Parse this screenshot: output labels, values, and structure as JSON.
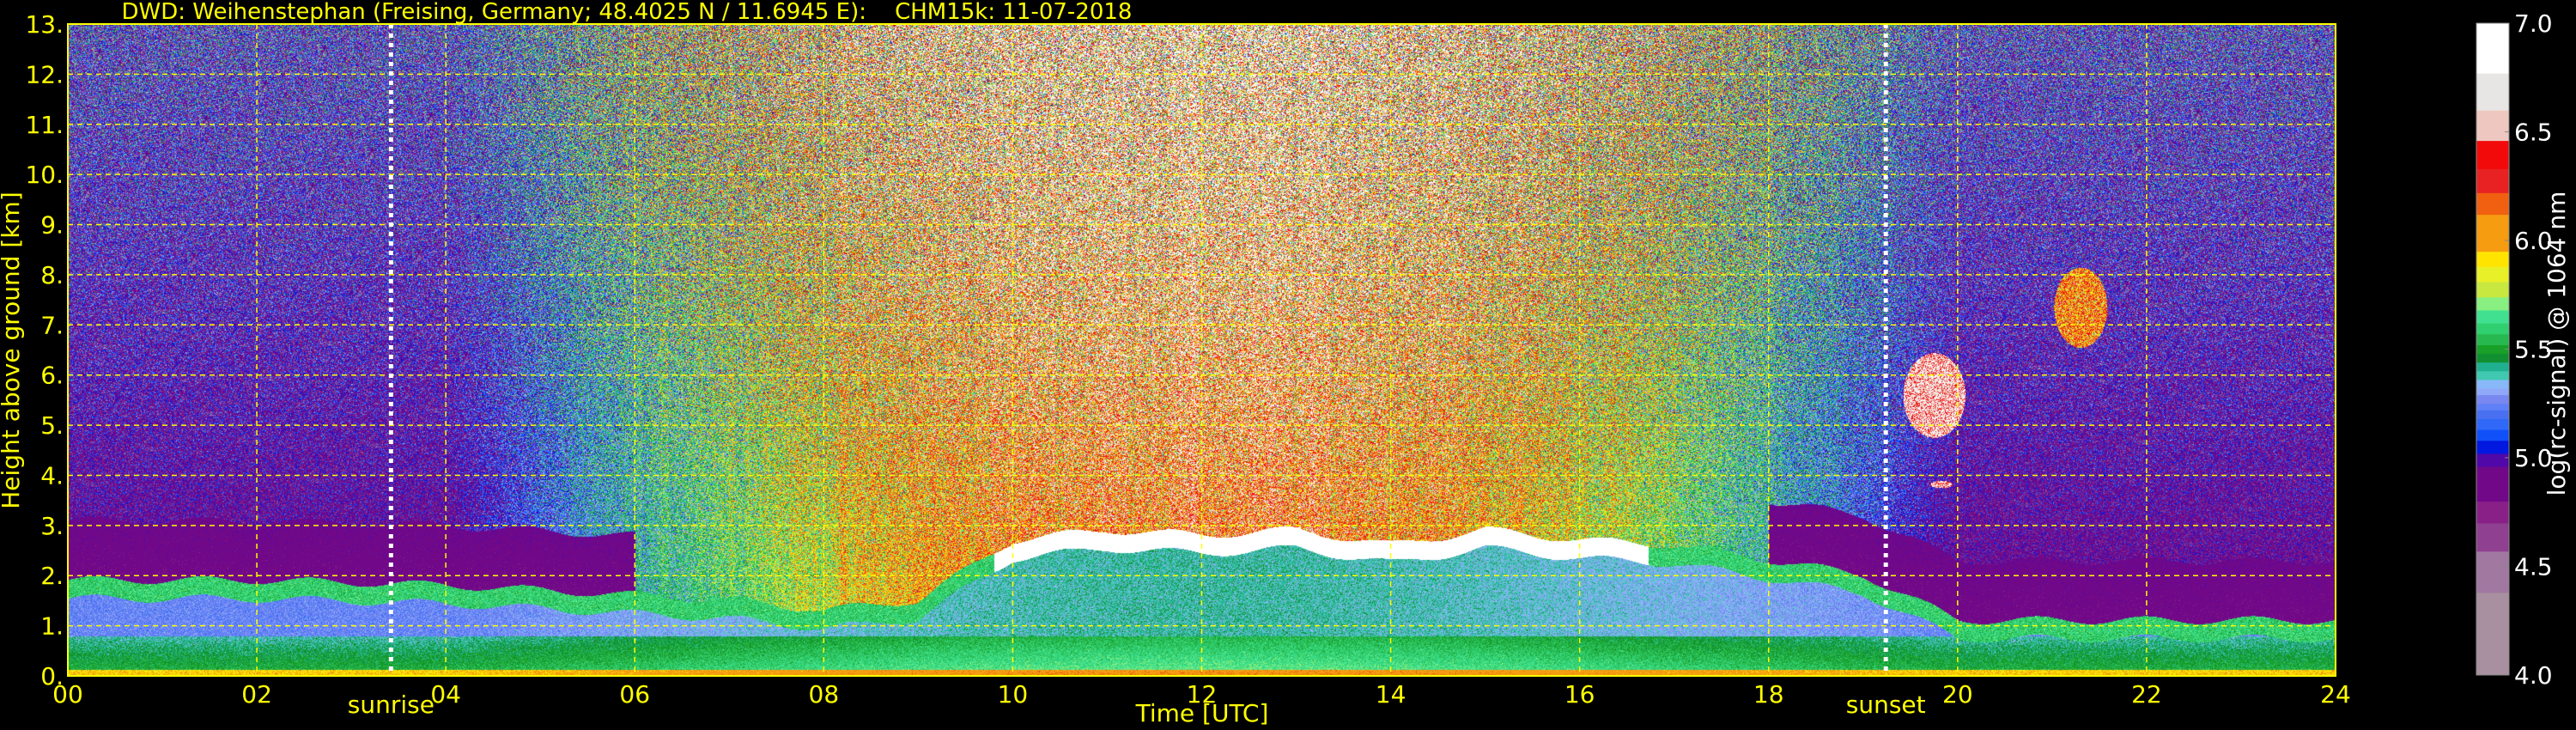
{
  "chart_data": {
    "type": "heatmap",
    "title": "DWD: Weihenstephan (Freising, Germany; 48.4025 N / 11.6945 E):    CHM15k: 11-07-2018",
    "xlabel": "Time [UTC]",
    "ylabel": "Height above ground [km]",
    "xlim": [
      0,
      24
    ],
    "ylim": [
      0,
      13
    ],
    "x_ticks": [
      "00",
      "02",
      "04",
      "06",
      "08",
      "10",
      "12",
      "14",
      "16",
      "18",
      "20",
      "22",
      "24"
    ],
    "y_ticks": [
      "0.",
      "1.",
      "2.",
      "3.",
      "4.",
      "5.",
      "6.",
      "7.",
      "8.",
      "9.",
      "10.",
      "11.",
      "12.",
      "13."
    ],
    "grid": true,
    "annotations": [
      {
        "label": "sunrise",
        "time_utc": 3.42
      },
      {
        "label": "sunset",
        "time_utc": 19.24
      }
    ],
    "boundary_layer_top_km": {
      "time_utc": [
        0,
        2,
        4,
        6,
        7,
        8,
        9,
        10,
        11,
        12,
        13,
        14,
        15,
        16,
        17,
        18,
        19,
        20,
        22,
        24
      ],
      "height_km": [
        1.8,
        1.8,
        1.7,
        1.5,
        1.4,
        1.2,
        1.4,
        2.6,
        2.8,
        2.7,
        2.8,
        2.5,
        2.8,
        2.6,
        2.5,
        2.2,
        1.9,
        1.0,
        1.0,
        1.0
      ]
    },
    "cloud_features": [
      {
        "time_utc": [
          10,
          17
        ],
        "height_km": [
          2.5,
          3.0
        ],
        "note_value": 7.0
      },
      {
        "time_utc": [
          19.4,
          20.1
        ],
        "height_km": [
          4.7,
          6.5
        ],
        "note_value": 7.0
      },
      {
        "time_utc": [
          21.0,
          21.6
        ],
        "height_km": [
          6.5,
          8.2
        ],
        "note_value": 6.5
      },
      {
        "time_utc": [
          19.7,
          19.95
        ],
        "height_km": [
          3.75,
          3.9
        ],
        "note_value": 7.0
      }
    ],
    "colorbar": {
      "label": "log(rc-signal) @ 1064 nm",
      "range": [
        4.0,
        7.0
      ],
      "ticks": [
        "4.0",
        "4.5",
        "5.0",
        "5.5",
        "6.0",
        "6.5",
        "7.0"
      ],
      "bands": [
        {
          "from": 4.0,
          "to": 4.38,
          "color": "#a890a0"
        },
        {
          "from": 4.38,
          "to": 4.57,
          "color": "#a078a0"
        },
        {
          "from": 4.57,
          "to": 4.7,
          "color": "#904090"
        },
        {
          "from": 4.7,
          "to": 4.8,
          "color": "#882088"
        },
        {
          "from": 4.8,
          "to": 4.96,
          "color": "#700888"
        },
        {
          "from": 4.96,
          "to": 5.02,
          "color": "#5008a8"
        },
        {
          "from": 5.02,
          "to": 5.08,
          "color": "#0018e0"
        },
        {
          "from": 5.08,
          "to": 5.13,
          "color": "#1050f8"
        },
        {
          "from": 5.13,
          "to": 5.18,
          "color": "#3068f8"
        },
        {
          "from": 5.18,
          "to": 5.22,
          "color": "#4870f0"
        },
        {
          "from": 5.22,
          "to": 5.25,
          "color": "#6080f8"
        },
        {
          "from": 5.25,
          "to": 5.29,
          "color": "#7888f0"
        },
        {
          "from": 5.29,
          "to": 5.32,
          "color": "#90a8f8"
        },
        {
          "from": 5.32,
          "to": 5.36,
          "color": "#88b8f8"
        },
        {
          "from": 5.36,
          "to": 5.4,
          "color": "#40c8b0"
        },
        {
          "from": 5.4,
          "to": 5.44,
          "color": "#20b090"
        },
        {
          "from": 5.44,
          "to": 5.48,
          "color": "#109030"
        },
        {
          "from": 5.48,
          "to": 5.52,
          "color": "#18a028"
        },
        {
          "from": 5.52,
          "to": 5.57,
          "color": "#28b850"
        },
        {
          "from": 5.57,
          "to": 5.62,
          "color": "#30d070"
        },
        {
          "from": 5.62,
          "to": 5.68,
          "color": "#40e090"
        },
        {
          "from": 5.68,
          "to": 5.74,
          "color": "#88f080"
        },
        {
          "from": 5.74,
          "to": 5.81,
          "color": "#c8e840"
        },
        {
          "from": 5.81,
          "to": 5.88,
          "color": "#e8f028"
        },
        {
          "from": 5.88,
          "to": 5.95,
          "color": "#ffe400"
        },
        {
          "from": 5.95,
          "to": 6.12,
          "color": "#f59c10"
        },
        {
          "from": 6.12,
          "to": 6.22,
          "color": "#f06010"
        },
        {
          "from": 6.22,
          "to": 6.33,
          "color": "#e82222"
        },
        {
          "from": 6.33,
          "to": 6.46,
          "color": "#f20a0a"
        },
        {
          "from": 6.46,
          "to": 6.6,
          "color": "#eec8c0"
        },
        {
          "from": 6.6,
          "to": 6.77,
          "color": "#e8e6e4"
        },
        {
          "from": 6.77,
          "to": 7.0,
          "color": "#ffffff"
        }
      ]
    },
    "colors": {
      "axis_text": "#ffff00",
      "grid": "#ffff00",
      "colorbar_text": "#ffffff",
      "background": "#000000"
    }
  }
}
